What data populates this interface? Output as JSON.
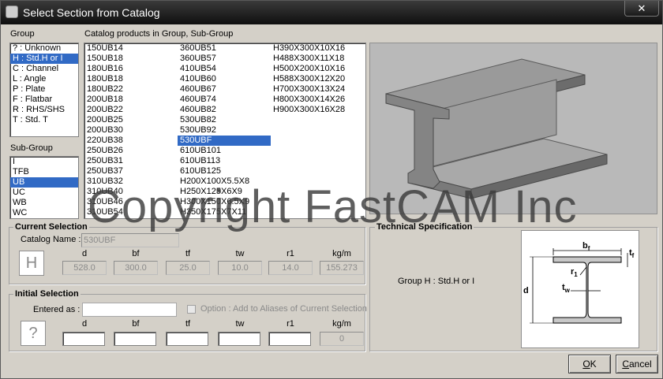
{
  "window": {
    "title": "Select Section from Catalog",
    "close_glyph": "✕"
  },
  "group": {
    "label": "Group",
    "items": [
      "? : Unknown",
      "H : Std.H or I",
      "C : Channel",
      "L : Angle",
      "P : Plate",
      "F : Flatbar",
      "R : RHS/SHS",
      "T : Std. T"
    ],
    "selected": 1
  },
  "subgroup": {
    "label": "Sub-Group",
    "items": [
      "I",
      "TFB",
      "UB",
      "UC",
      "WB",
      "WC"
    ],
    "selected": 2
  },
  "catalog": {
    "label": "Catalog products in Group, Sub-Group",
    "col1": [
      "150UB14",
      "150UB18",
      "180UB16",
      "180UB18",
      "180UB22",
      "200UB18",
      "200UB22",
      "200UB25",
      "200UB30",
      "220UB38",
      "250UB26",
      "250UB31",
      "250UB37",
      "310UB32",
      "310UB40",
      "310UB46",
      "310UB54"
    ],
    "col2": [
      "360UB51",
      "360UB57",
      "410UB54",
      "410UB60",
      "460UB67",
      "460UB74",
      "460UB82",
      "530UB82",
      "530UB92",
      "530UBF",
      "610UB101",
      "610UB113",
      "610UB125",
      "H200X100X5.5X8",
      "H250X125X6X9",
      "H300X150X6.5X9",
      "H350X175X7X11"
    ],
    "col3": [
      "H390X300X10X16",
      "H488X300X11X18",
      "H500X200X10X16",
      "H588X300X12X20",
      "H700X300X13X24",
      "H800X300X14X26",
      "H900X300X16X28"
    ],
    "selected": "530UBF"
  },
  "current_selection": {
    "title": "Current Selection",
    "catalog_name_label": "Catalog Name :",
    "catalog_name": "530UBF",
    "group_glyph": "H",
    "headers": [
      "d",
      "bf",
      "tf",
      "tw",
      "r1",
      "kg/m"
    ],
    "values": [
      "528.0",
      "300.0",
      "25.0",
      "10.0",
      "14.0",
      "155.273"
    ]
  },
  "initial_selection": {
    "title": "Initial Selection",
    "entered_as_label": "Entered as :",
    "entered_as_value": "",
    "option_label": "Option : Add to Aliases of Current Selection",
    "group_glyph": "?",
    "headers": [
      "d",
      "bf",
      "tf",
      "tw",
      "r1",
      "kg/m"
    ],
    "values": [
      "",
      "",
      "",
      "",
      "",
      "0"
    ]
  },
  "technical": {
    "title": "Technical Specification",
    "group_text": "Group H : Std.H or I",
    "diagram_labels": {
      "bf": "b",
      "bf_sub": "f",
      "tf": "t",
      "tf_sub": "f",
      "r1": "r",
      "r1_sub": "1",
      "tw": "t",
      "tw_sub": "w",
      "d": "d"
    }
  },
  "buttons": {
    "ok_u": "O",
    "ok_rest": "K",
    "cancel_u": "C",
    "cancel_rest": "ancel"
  },
  "watermark": "Copyright FastCAM Inc"
}
